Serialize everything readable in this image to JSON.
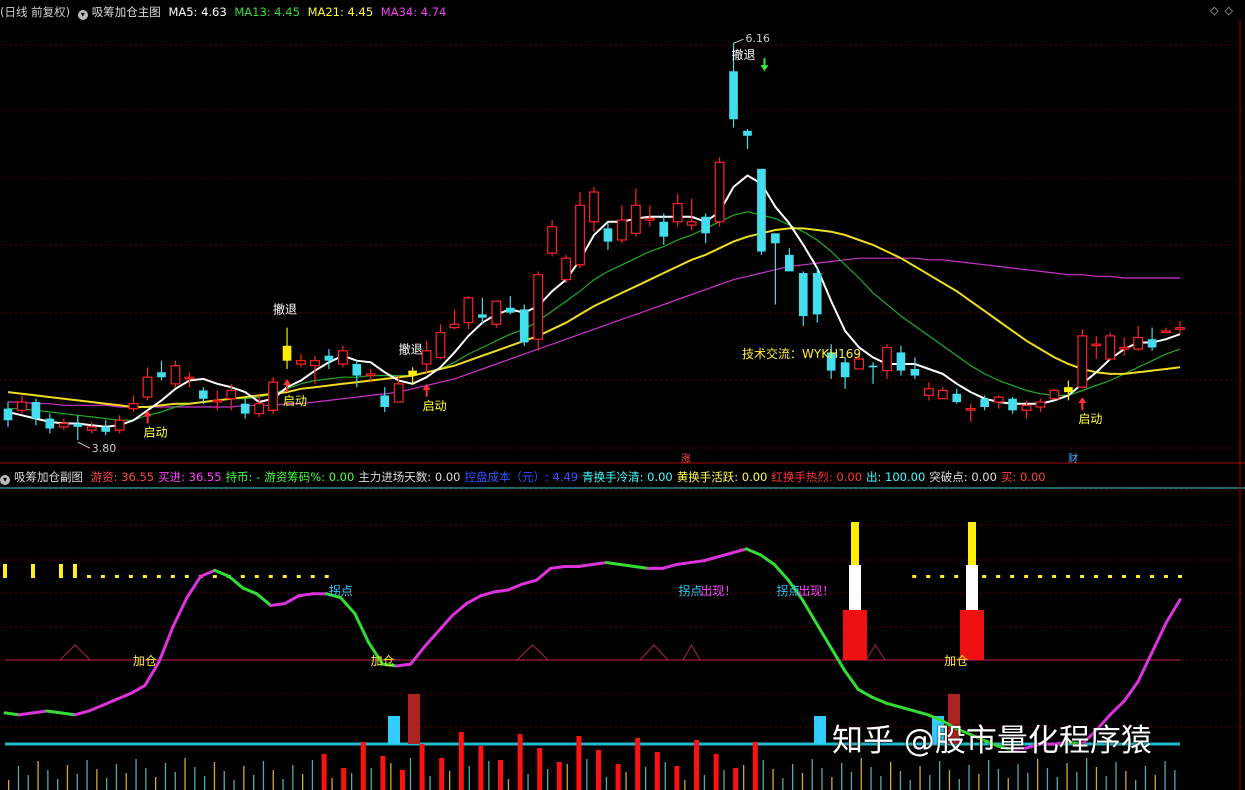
{
  "main_header": {
    "prefix": "(日线 前复权)",
    "indicator_name": "吸筹加仓主图",
    "ma5": "MA5: 4.63",
    "ma13": "MA13: 4.45",
    "ma21": "MA21: 4.45",
    "ma34": "MA34: 4.74"
  },
  "sub_header": {
    "indicator_name": "吸筹加仓副图",
    "items": [
      {
        "text": "游资: 36.55",
        "color": "#ff4444"
      },
      {
        "text": "买进: 36.55",
        "color": "#ff44ff"
      },
      {
        "text": "持币: -",
        "color": "#44ff44"
      },
      {
        "text": "游资筹码%: 0.00",
        "color": "#44ff44"
      },
      {
        "text": "主力进场天数: 0.00",
        "color": "#dddddd"
      },
      {
        "text": "控盘成本（元）: 4.49",
        "color": "#3355ff"
      },
      {
        "text": "青换手冷清: 0.00",
        "color": "#44ffff"
      },
      {
        "text": "黄换手活跃: 0.00",
        "color": "#ffff44"
      },
      {
        "text": "红换手热烈: 0.00",
        "color": "#ff3333"
      },
      {
        "text": "出: 100.00",
        "color": "#44ffff"
      },
      {
        "text": "突破点: 0.00",
        "color": "#dddddd"
      },
      {
        "text": "买: 0.00",
        "color": "#ff4444"
      }
    ]
  },
  "chart_data": {
    "type": "candlestick",
    "candles": [
      [
        3.95,
        3.88,
        3.99,
        3.84
      ],
      [
        3.94,
        3.99,
        4.03,
        3.92
      ],
      [
        3.99,
        3.89,
        4.01,
        3.85
      ],
      [
        3.89,
        3.83,
        3.92,
        3.8
      ],
      [
        3.84,
        3.86,
        3.89,
        3.82
      ],
      [
        3.86,
        3.84,
        3.91,
        3.76
      ],
      [
        3.82,
        3.84,
        3.87,
        3.8
      ],
      [
        3.84,
        3.81,
        3.88,
        3.79
      ],
      [
        3.82,
        3.88,
        3.91,
        3.8
      ],
      [
        3.95,
        3.98,
        4.03,
        3.93
      ],
      [
        4.02,
        4.14,
        4.2,
        4.0
      ],
      [
        4.17,
        4.14,
        4.24,
        4.12
      ],
      [
        4.1,
        4.21,
        4.24,
        4.08
      ],
      [
        4.14,
        4.14,
        4.17,
        4.08
      ],
      [
        4.06,
        4.01,
        4.08,
        3.98
      ],
      [
        4.0,
        4.0,
        4.06,
        3.94
      ],
      [
        4.01,
        4.06,
        4.1,
        3.94
      ],
      [
        3.98,
        3.92,
        4.01,
        3.89
      ],
      [
        3.92,
        3.98,
        4.03,
        3.9
      ],
      [
        3.94,
        4.11,
        4.14,
        3.92
      ],
      [
        4.24,
        4.33,
        4.44,
        4.19
      ],
      [
        4.22,
        4.24,
        4.28,
        4.2
      ],
      [
        4.21,
        4.24,
        4.27,
        4.1
      ],
      [
        4.27,
        4.24,
        4.31,
        4.19
      ],
      [
        4.22,
        4.3,
        4.33,
        4.2
      ],
      [
        4.22,
        4.15,
        4.24,
        4.08
      ],
      [
        4.15,
        4.16,
        4.19,
        4.11
      ],
      [
        4.03,
        3.96,
        4.08,
        3.93
      ],
      [
        3.99,
        4.1,
        4.15,
        4.0
      ],
      [
        4.18,
        4.15,
        4.2,
        4.1
      ],
      [
        4.22,
        4.3,
        4.36,
        4.16
      ],
      [
        4.26,
        4.41,
        4.46,
        4.25
      ],
      [
        4.44,
        4.46,
        4.55,
        4.43
      ],
      [
        4.47,
        4.62,
        4.63,
        4.43
      ],
      [
        4.52,
        4.5,
        4.62,
        4.46
      ],
      [
        4.46,
        4.6,
        4.6,
        4.44
      ],
      [
        4.56,
        4.53,
        4.63,
        4.52
      ],
      [
        4.55,
        4.35,
        4.58,
        4.33
      ],
      [
        4.37,
        4.76,
        4.78,
        4.3
      ],
      [
        4.89,
        5.05,
        5.09,
        4.87
      ],
      [
        4.73,
        4.86,
        4.88,
        4.71
      ],
      [
        4.82,
        5.18,
        5.26,
        4.8
      ],
      [
        5.08,
        5.26,
        5.29,
        5.02
      ],
      [
        5.04,
        4.96,
        5.07,
        4.91
      ],
      [
        4.97,
        5.09,
        5.18,
        4.95
      ],
      [
        5.01,
        5.18,
        5.28,
        4.99
      ],
      [
        5.09,
        5.1,
        5.18,
        5.05
      ],
      [
        5.08,
        4.99,
        5.13,
        4.94
      ],
      [
        5.08,
        5.19,
        5.25,
        5.05
      ],
      [
        5.06,
        5.08,
        5.22,
        5.03
      ],
      [
        5.11,
        5.01,
        5.13,
        4.95
      ],
      [
        5.08,
        5.44,
        5.47,
        5.05
      ],
      [
        5.99,
        5.7,
        6.16,
        5.65
      ],
      [
        5.63,
        5.6,
        5.64,
        5.52
      ],
      [
        5.4,
        4.9,
        5.4,
        4.88
      ],
      [
        5.01,
        4.95,
        5.01,
        4.58
      ],
      [
        4.88,
        4.78,
        4.92,
        4.78
      ],
      [
        4.77,
        4.51,
        4.78,
        4.45
      ],
      [
        4.77,
        4.52,
        4.8,
        4.47
      ],
      [
        4.29,
        4.18,
        4.34,
        4.13
      ],
      [
        4.23,
        4.14,
        4.26,
        4.07
      ],
      [
        4.19,
        4.25,
        4.28,
        4.19
      ],
      [
        4.21,
        4.2,
        4.23,
        4.1
      ],
      [
        4.18,
        4.32,
        4.34,
        4.13
      ],
      [
        4.29,
        4.18,
        4.33,
        4.15
      ],
      [
        4.19,
        4.15,
        4.26,
        4.13
      ],
      [
        4.03,
        4.07,
        4.11,
        4.0
      ],
      [
        4.01,
        4.06,
        4.08,
        4.01
      ],
      [
        4.04,
        3.99,
        4.07,
        3.98
      ],
      [
        3.95,
        3.95,
        3.98,
        3.87
      ],
      [
        4.01,
        3.96,
        4.03,
        3.94
      ],
      [
        3.99,
        4.02,
        4.03,
        3.95
      ],
      [
        4.01,
        3.94,
        4.02,
        3.92
      ],
      [
        3.94,
        3.97,
        4.0,
        3.89
      ],
      [
        3.96,
        3.99,
        4.01,
        3.93
      ],
      [
        4.01,
        4.06,
        4.07,
        4.01
      ],
      [
        4.05,
        4.08,
        4.12,
        4.0
      ],
      [
        4.08,
        4.39,
        4.43,
        4.08
      ],
      [
        4.34,
        4.34,
        4.39,
        4.25
      ],
      [
        4.25,
        4.39,
        4.41,
        4.24
      ],
      [
        4.31,
        4.32,
        4.38,
        4.27
      ],
      [
        4.31,
        4.38,
        4.45,
        4.3
      ],
      [
        4.37,
        4.32,
        4.44,
        4.3
      ],
      [
        4.42,
        4.42,
        4.44,
        4.41
      ],
      [
        4.43,
        4.44,
        4.48,
        4.4
      ]
    ],
    "ma5": [
      3.93,
      3.91,
      3.89,
      3.87,
      3.86,
      3.86,
      3.85,
      3.84,
      3.85,
      3.88,
      3.94,
      4.0,
      4.07,
      4.12,
      4.13,
      4.1,
      4.08,
      4.05,
      3.99,
      4.01,
      4.08,
      4.12,
      4.18,
      4.23,
      4.27,
      4.24,
      4.23,
      4.17,
      4.12,
      4.1,
      4.14,
      4.2,
      4.29,
      4.39,
      4.47,
      4.52,
      4.55,
      4.53,
      4.57,
      4.66,
      4.73,
      4.85,
      5.0,
      5.08,
      5.08,
      5.1,
      5.11,
      5.11,
      5.11,
      5.11,
      5.08,
      5.14,
      5.29,
      5.36,
      5.31,
      5.17,
      5.07,
      4.94,
      4.8,
      4.6,
      4.42,
      4.32,
      4.26,
      4.22,
      4.22,
      4.22,
      4.19,
      4.16,
      4.1,
      4.05,
      4.01,
      3.99,
      3.98,
      3.98,
      3.98,
      4.0,
      4.03,
      4.1,
      4.17,
      4.25,
      4.31,
      4.35,
      4.35,
      4.37,
      4.4
    ],
    "ma13": [
      3.95,
      3.95,
      3.94,
      3.93,
      3.92,
      3.91,
      3.9,
      3.89,
      3.88,
      3.88,
      3.91,
      3.93,
      3.96,
      3.98,
      3.99,
      4.0,
      4.01,
      4.01,
      4.02,
      4.04,
      4.07,
      4.1,
      4.12,
      4.13,
      4.14,
      4.14,
      4.15,
      4.15,
      4.15,
      4.15,
      4.17,
      4.19,
      4.23,
      4.28,
      4.32,
      4.36,
      4.4,
      4.43,
      4.48,
      4.54,
      4.6,
      4.66,
      4.73,
      4.78,
      4.82,
      4.86,
      4.9,
      4.93,
      4.97,
      5.0,
      5.04,
      5.08,
      5.12,
      5.14,
      5.12,
      5.1,
      5.06,
      5.02,
      4.97,
      4.9,
      4.82,
      4.74,
      4.65,
      4.58,
      4.51,
      4.45,
      4.39,
      4.33,
      4.27,
      4.21,
      4.16,
      4.12,
      4.09,
      4.06,
      4.04,
      4.03,
      4.03,
      4.06,
      4.09,
      4.12,
      4.16,
      4.2,
      4.24,
      4.28,
      4.31
    ],
    "ma21": [
      4.05,
      4.04,
      4.03,
      4.02,
      4.01,
      4.0,
      3.99,
      3.98,
      3.97,
      3.96,
      3.96,
      3.97,
      3.98,
      3.98,
      3.99,
      4.0,
      4.01,
      4.02,
      4.03,
      4.04,
      4.05,
      4.07,
      4.08,
      4.09,
      4.1,
      4.11,
      4.12,
      4.13,
      4.14,
      4.15,
      4.17,
      4.19,
      4.21,
      4.24,
      4.27,
      4.3,
      4.33,
      4.36,
      4.39,
      4.43,
      4.47,
      4.52,
      4.57,
      4.61,
      4.65,
      4.69,
      4.73,
      4.77,
      4.81,
      4.85,
      4.88,
      4.92,
      4.96,
      4.99,
      5.01,
      5.03,
      5.04,
      5.04,
      5.03,
      5.02,
      5.0,
      4.97,
      4.94,
      4.9,
      4.86,
      4.81,
      4.76,
      4.71,
      4.66,
      4.6,
      4.54,
      4.48,
      4.42,
      4.36,
      4.31,
      4.26,
      4.22,
      4.19,
      4.17,
      4.16,
      4.16,
      4.17,
      4.18,
      4.19,
      4.2
    ],
    "ma34": [
      3.99,
      3.99,
      3.98,
      3.98,
      3.97,
      3.97,
      3.97,
      3.97,
      3.96,
      3.96,
      3.96,
      3.96,
      3.96,
      3.96,
      3.96,
      3.96,
      3.96,
      3.97,
      3.97,
      3.97,
      3.98,
      3.98,
      3.99,
      4.0,
      4.01,
      4.02,
      4.03,
      4.04,
      4.05,
      4.07,
      4.09,
      4.11,
      4.13,
      4.16,
      4.19,
      4.22,
      4.25,
      4.28,
      4.31,
      4.34,
      4.37,
      4.4,
      4.43,
      4.46,
      4.49,
      4.52,
      4.55,
      4.58,
      4.61,
      4.64,
      4.67,
      4.7,
      4.73,
      4.75,
      4.77,
      4.79,
      4.81,
      4.82,
      4.83,
      4.84,
      4.85,
      4.86,
      4.86,
      4.86,
      4.86,
      4.86,
      4.85,
      4.85,
      4.84,
      4.83,
      4.82,
      4.81,
      4.8,
      4.79,
      4.78,
      4.77,
      4.76,
      4.76,
      4.75,
      4.75,
      4.74,
      4.74,
      4.74,
      4.74,
      4.74
    ],
    "annotations": [
      {
        "text": "3.80",
        "i": 5,
        "type": "low"
      },
      {
        "text": "6.16",
        "i": 52,
        "type": "high"
      },
      {
        "text": "启动",
        "i": 10,
        "type": "buy"
      },
      {
        "text": "启动",
        "i": 20,
        "type": "buy"
      },
      {
        "text": "启动",
        "i": 30,
        "type": "buy"
      },
      {
        "text": "启动",
        "i": 77,
        "type": "buy"
      },
      {
        "text": "撤退",
        "i": 20,
        "type": "sell"
      },
      {
        "text": "撤退",
        "i": 29,
        "type": "sell"
      },
      {
        "text": "撤退",
        "i": 52,
        "type": "sell"
      }
    ],
    "yellow_candles": [
      20,
      29,
      76
    ],
    "contact_text": "技术交流：WYKH169",
    "axis_marks": [
      "涨",
      "财"
    ],
    "sub": {
      "main_line": [
        4,
        3,
        4,
        5,
        4,
        3,
        5,
        8,
        11,
        14,
        18,
        30,
        48,
        63,
        74,
        77,
        74,
        68,
        65,
        59,
        60,
        64,
        65,
        65,
        63,
        55,
        40,
        29,
        28,
        29,
        38,
        46,
        54,
        60,
        64,
        66,
        67,
        70,
        72,
        78,
        79,
        79,
        80,
        81,
        80,
        79,
        78,
        78,
        80,
        81,
        82,
        84,
        86,
        88,
        85,
        80,
        72,
        62,
        50,
        38,
        26,
        16,
        12,
        9,
        7,
        5,
        3,
        0,
        -4,
        -7,
        -10,
        -13,
        -15,
        -14,
        -12,
        -12,
        -11,
        -12,
        -5,
        3,
        10,
        20,
        35,
        50,
        62
      ],
      "yellow_bars": [
        1,
        0,
        1,
        0,
        1,
        1,
        1,
        1,
        1,
        1,
        1,
        1,
        1,
        1,
        1,
        1,
        1,
        1,
        1,
        1,
        1,
        1,
        1,
        1,
        0,
        0,
        0,
        0,
        0,
        0,
        0,
        0,
        0,
        0,
        0,
        0,
        0,
        0,
        0,
        0,
        0,
        0,
        0,
        0,
        0,
        0,
        0,
        0,
        0,
        0,
        0,
        0,
        0,
        0,
        0,
        0,
        0,
        0,
        0,
        0,
        0,
        0,
        0,
        0,
        0,
        1,
        1,
        1,
        1,
        1,
        1,
        1,
        1,
        1,
        1,
        1,
        1,
        1,
        1,
        1,
        1,
        1,
        1,
        1,
        1
      ],
      "labels": [
        {
          "text": "加仓",
          "i": 10
        },
        {
          "text": "拐点",
          "i": 24
        },
        {
          "text": "加仓",
          "i": 27
        },
        {
          "text": "拐点",
          "i": 49
        },
        {
          "text": "出现！",
          "i": 51
        },
        {
          "text": "拐点",
          "i": 56
        },
        {
          "text": "出现！",
          "i": 58
        },
        {
          "text": "加仓",
          "i": 68
        }
      ]
    }
  },
  "watermark": "知乎 @股市量化程序猿"
}
